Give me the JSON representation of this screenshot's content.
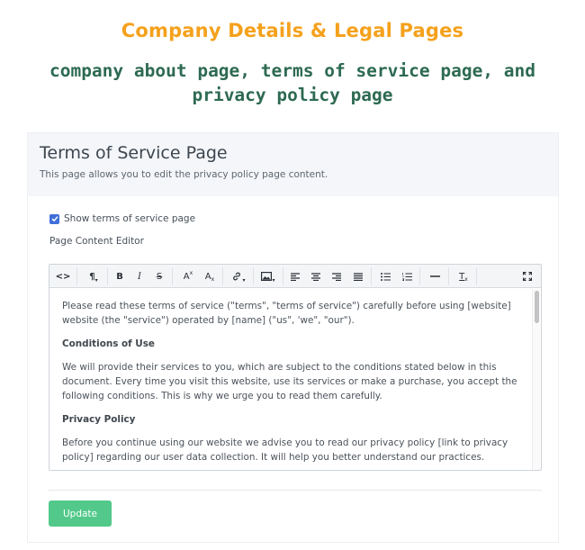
{
  "banner": {
    "title": "Company Details & Legal Pages",
    "subtitle": "company about page, terms of service page, and privacy policy page"
  },
  "card": {
    "title": "Terms of Service Page",
    "description": "This page allows you to edit the privacy policy page content."
  },
  "form": {
    "checkbox_label": "Show terms of service page",
    "checkbox_checked": true,
    "editor_label": "Page Content Editor",
    "update_button": "Update"
  },
  "toolbar": {
    "code": "<>",
    "paragraph": "¶",
    "bold": "B",
    "italic": "I",
    "strikethrough": "S",
    "superscript": "A",
    "subscript": "A",
    "link": "link",
    "image": "image",
    "align_left": "align-left",
    "align_center": "align-center",
    "align_right": "align-right",
    "justify": "justify",
    "bullet_list": "bullet-list",
    "numbered_list": "numbered-list",
    "horizontal_rule": "hr",
    "clear_format": "T",
    "fullscreen": "fullscreen"
  },
  "editor_content": {
    "intro": "Please read these terms of service (\"terms\", \"terms of service\") carefully before using [website] website (the \"service\") operated by [name] (\"us\", 'we\", \"our\").",
    "h1": "Conditions of Use",
    "p1": "We will provide their services to you, which are subject to the conditions stated below in this document. Every time you visit this website, use its services or make a purchase, you accept the following conditions. This is why we urge you to read them carefully.",
    "h2": "Privacy Policy",
    "p2": "Before you continue using our website we advise you to read our privacy policy [link to privacy policy] regarding our user data collection. It will help you better understand our practices."
  },
  "colors": {
    "accent_orange": "#f5a11c",
    "accent_green_text": "#2d6a52",
    "button_green": "#52c98a",
    "checkbox_blue": "#3f6fd8"
  }
}
